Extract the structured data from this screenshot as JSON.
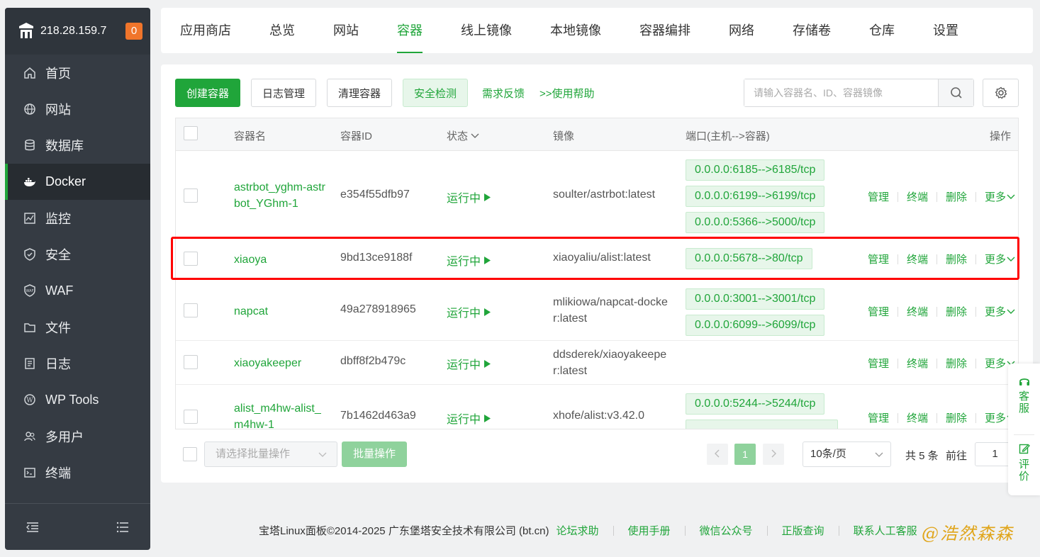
{
  "sidebar": {
    "ip": "218.28.159.7",
    "badge": "0",
    "items": [
      {
        "label": "首页",
        "icon": "home-icon"
      },
      {
        "label": "网站",
        "icon": "globe-icon"
      },
      {
        "label": "数据库",
        "icon": "database-icon"
      },
      {
        "label": "Docker",
        "icon": "docker-icon"
      },
      {
        "label": "监控",
        "icon": "monitor-icon"
      },
      {
        "label": "安全",
        "icon": "shield-icon"
      },
      {
        "label": "WAF",
        "icon": "waf-icon"
      },
      {
        "label": "文件",
        "icon": "folder-icon"
      },
      {
        "label": "日志",
        "icon": "log-icon"
      },
      {
        "label": "WP Tools",
        "icon": "wordpress-icon"
      },
      {
        "label": "多用户",
        "icon": "users-icon"
      },
      {
        "label": "终端",
        "icon": "terminal-icon"
      }
    ],
    "active_index": 3
  },
  "tabs": [
    "应用商店",
    "总览",
    "网站",
    "容器",
    "线上镜像",
    "本地镜像",
    "容器编排",
    "网络",
    "存储卷",
    "仓库",
    "设置"
  ],
  "active_tab": "容器",
  "toolbar": {
    "create": "创建容器",
    "logs": "日志管理",
    "clean": "清理容器",
    "security": "安全检测",
    "feedback": "需求反馈",
    "help": ">>使用帮助",
    "search_placeholder": "请输入容器名、ID、容器镜像"
  },
  "table": {
    "headers": {
      "name": "容器名",
      "id": "容器ID",
      "status": "状态",
      "image": "镜像",
      "ports": "端口(主机-->容器)",
      "ops": "操作"
    },
    "ops_labels": {
      "manage": "管理",
      "terminal": "终端",
      "delete": "删除",
      "more": "更多"
    },
    "rows": [
      {
        "name": "astrbot_yghm-astrbot_YGhm-1",
        "id": "e354f55dfb97",
        "status": "运行中",
        "image": "soulter/astrbot:latest",
        "ports": [
          "0.0.0.0:6185-->6185/tcp",
          "0.0.0.0:6199-->6199/tcp",
          "0.0.0.0:5366-->5000/tcp"
        ]
      },
      {
        "name": "xiaoya",
        "id": "9bd13ce9188f",
        "status": "运行中",
        "image": "xiaoyaliu/alist:latest",
        "ports": [
          "0.0.0.0:5678-->80/tcp"
        ]
      },
      {
        "name": "napcat",
        "id": "49a278918965",
        "status": "运行中",
        "image": "mlikiowa/napcat-docker:latest",
        "ports": [
          "0.0.0.0:3001-->3001/tcp",
          "0.0.0.0:6099-->6099/tcp"
        ]
      },
      {
        "name": "xiaoyakeeper",
        "id": "dbff8f2b479c",
        "status": "运行中",
        "image": "ddsderek/xiaoyakeeper:latest",
        "ports": []
      },
      {
        "name": "alist_m4hw-alist_m4hw-1",
        "id": "7b1462d463a9",
        "status": "运行中",
        "image": "xhofe/alist:v3.42.0",
        "ports": [
          "0.0.0.0:5244-->5244/tcp"
        ]
      }
    ]
  },
  "bottom": {
    "batch_placeholder": "请选择批量操作",
    "batch_button": "批量操作",
    "current_page": "1",
    "per_page": "10条/页",
    "total": "共 5 条",
    "goto": "前往",
    "goto_value": "1"
  },
  "footer": {
    "copyright": "宝塔Linux面板©2014-2025 广东堡塔安全技术有限公司 (bt.cn)",
    "links": [
      "论坛求助",
      "使用手册",
      "微信公众号",
      "正版查询",
      "联系人工客服"
    ]
  },
  "float": {
    "service": "客服",
    "review": "评价"
  },
  "colors": {
    "accent": "#20a53a",
    "sidebar": "#353b43",
    "highlight": "#ff0000"
  }
}
